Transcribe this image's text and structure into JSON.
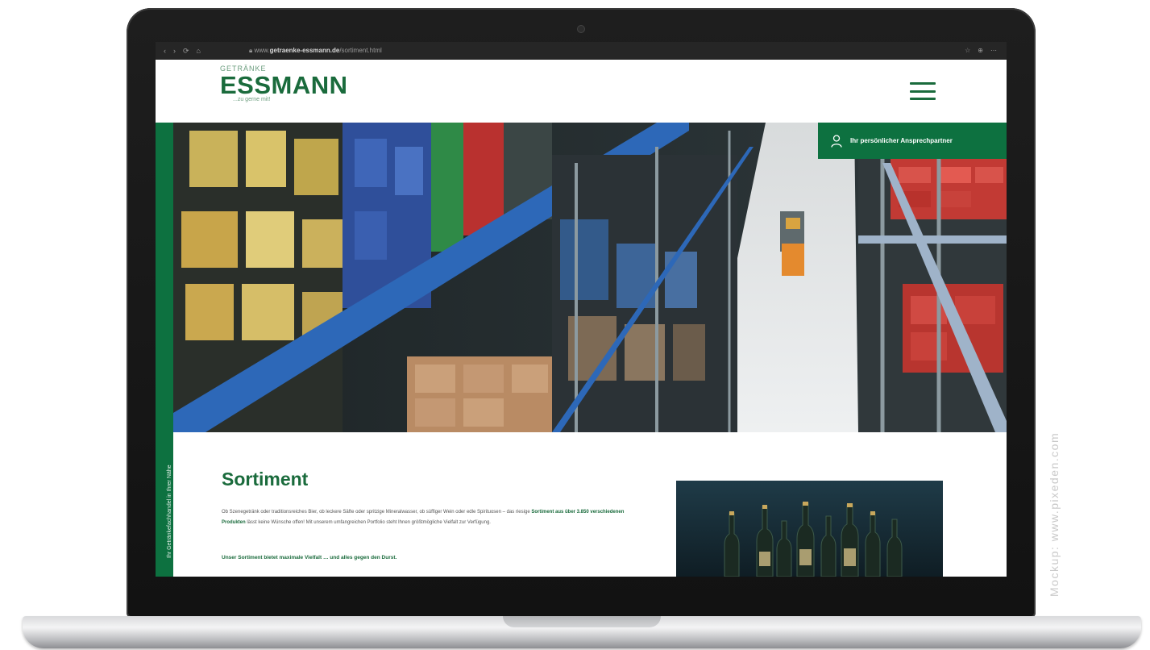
{
  "browser": {
    "controls": [
      "‹",
      "›",
      "⟳",
      "⌂"
    ],
    "url_prefix": "www.",
    "url_domain": "getraenke-essmann.de",
    "url_path": "/sortiment.html",
    "tool_icons": [
      "☆",
      "⊕",
      "⋯"
    ]
  },
  "site": {
    "logo_small": "GETRÄNKE",
    "logo_main": "ESSMANN",
    "logo_tagline": "...zu gerne mit!",
    "contact_label": "Ihr persönlicher Ansprechpartner",
    "side_text": "Ihr Getränkefachhandel in Ihrer Nähe",
    "menu_icon": "hamburger-icon"
  },
  "content": {
    "title": "Sortiment",
    "paragraph_1": "Ob Szenegetränk oder traditionsreiches Bier, ob leckere Säfte oder spritzige Mineralwasser, ob süffiger Wein oder edle Spirituosen – das riesige",
    "paragraph_bold": "Sortiment aus über 3.850 verschiedenen Produkten",
    "paragraph_2": "lässt keine Wünsche offen! Mit unserem umfangreichen Portfolio steht Ihnen größtmögliche Vielfalt zur Verfügung.",
    "cta": "Unser Sortiment bietet maximale Vielfalt … und alles gegen den Durst."
  },
  "watermark": "Mockup: www.pixeden.com",
  "colors": {
    "brand_green": "#1a6b3c",
    "strip_green": "#0d7140",
    "laptop_frame": "#161616"
  }
}
